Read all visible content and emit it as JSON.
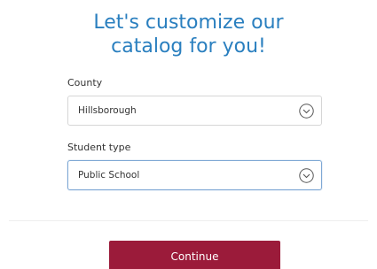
{
  "title": {
    "line1": "Let's customize our",
    "line2": "catalog for you!"
  },
  "county": {
    "label": "County",
    "value": "Hillsborough"
  },
  "student_type": {
    "label": "Student type",
    "value": "Public School"
  },
  "continue_label": "Continue",
  "colors": {
    "title": "#2a7fbf",
    "button": "#9b1b3a",
    "focus_border": "#7ea8d4"
  }
}
